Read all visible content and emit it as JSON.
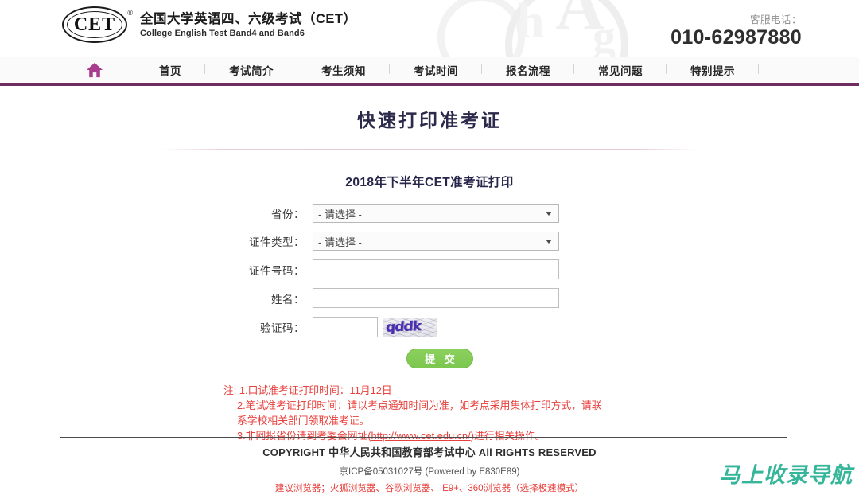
{
  "header": {
    "logo_mark": "CET",
    "logo_reg": "®",
    "title_cn": "全国大学英语四、六级考试（CET）",
    "title_en": "College English Test Band4 and Band6",
    "hotline_label": "客服电话：",
    "hotline_number": "010-62987880",
    "watermark_letters": [
      "A",
      "h",
      "g"
    ]
  },
  "nav": {
    "home_icon": "home-icon",
    "items": [
      {
        "label": "首页"
      },
      {
        "label": "考试简介"
      },
      {
        "label": "考生须知"
      },
      {
        "label": "考试时间"
      },
      {
        "label": "报名流程"
      },
      {
        "label": "常见问题"
      },
      {
        "label": "特别提示"
      }
    ]
  },
  "main": {
    "page_title": "快速打印准考证",
    "form_subtitle": "2018年下半年CET准考证打印",
    "fields": {
      "province": {
        "label": "省份：",
        "value": "- 请选择 -"
      },
      "id_type": {
        "label": "证件类型：",
        "value": "- 请选择 -"
      },
      "id_number": {
        "label": "证件号码：",
        "value": "",
        "placeholder": ""
      },
      "name": {
        "label": "姓名：",
        "value": "",
        "placeholder": ""
      },
      "captcha": {
        "label": "验证码：",
        "value": "",
        "placeholder": "",
        "image_text": "qddk"
      }
    },
    "submit_label": "提 交",
    "notes": {
      "line1": "注: 1.口试准考证打印时间：11月12日",
      "line2": "2.笔试准考证打印时间：请以考点通知时间为准，如考点采用集体打印方式，请联",
      "line2b": "系学校相关部门领取准考证。",
      "line3_before": "3.非网报省份请到考委会网址(",
      "line3_link": "http://www.cet.edu.cn/",
      "line3_after": ")进行相关操作。"
    }
  },
  "footer": {
    "copyright": "COPYRIGHT 中华人民共和国教育部考试中心 All RIGHTS RESERVED",
    "icp": "京ICP备05031027号 (Powered by  E830E89)",
    "browser_tip": "建议浏览器；火狐浏览器、谷歌浏览器、IE9+、360浏览器（选择极速模式）"
  },
  "watermark": {
    "brand": "马上收录导航"
  },
  "colors": {
    "nav_underline": "#6f2d62",
    "title": "#2b2a4a",
    "note_red": "#e8403c",
    "submit_green": "#7cc74f",
    "brand_teal": "#35b59a"
  }
}
